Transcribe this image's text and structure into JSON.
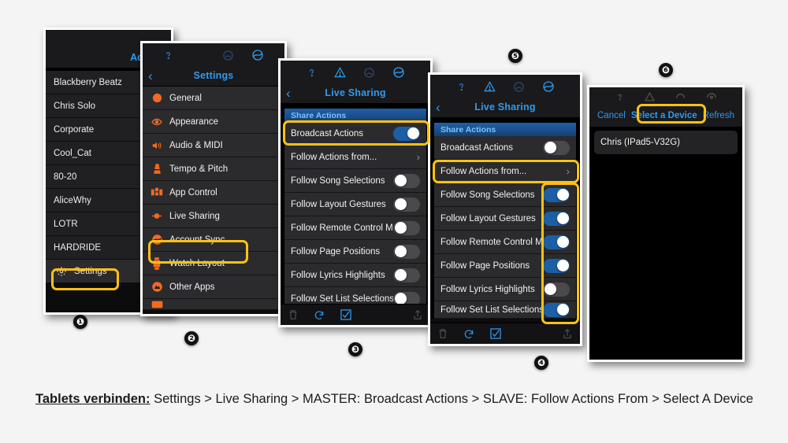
{
  "background_color": "#f4f4f4",
  "accent_highlight_color": "#fec212",
  "accent_blue": "#2f9aee",
  "toggle_on_color": "#1c5fa5",
  "toggle_off_color": "#4a4a4c",
  "panels": {
    "accounts": {
      "marker": "❶",
      "title": "Accoun",
      "items": [
        {
          "label": "Blackberry Beatz"
        },
        {
          "label": "Chris Solo"
        },
        {
          "label": "Corporate"
        },
        {
          "label": "Cool_Cat"
        },
        {
          "label": "80-20"
        },
        {
          "label": "AliceWhy"
        },
        {
          "label": "LOTR"
        },
        {
          "label": "HARDRIDE"
        }
      ],
      "settings_row": {
        "label": "Settings",
        "icon": "gear-icon",
        "highlighted": true
      }
    },
    "settings": {
      "marker": "❷",
      "title": "Settings",
      "back": "‹",
      "status_icons": [
        "help-icon",
        "metronome-icon",
        "sync-icon"
      ],
      "items": [
        {
          "label": "General",
          "icon": "gear-icon"
        },
        {
          "label": "Appearance",
          "icon": "eye-icon"
        },
        {
          "label": "Audio & MIDI",
          "icon": "speaker-icon"
        },
        {
          "label": "Tempo & Pitch",
          "icon": "metronome-icon"
        },
        {
          "label": "App Control",
          "icon": "app-control-icon"
        },
        {
          "label": "Live Sharing",
          "icon": "live-sharing-icon",
          "highlighted": true
        },
        {
          "label": "Account Sync",
          "icon": "sync-icon"
        },
        {
          "label": "Watch Layout",
          "icon": "watch-icon"
        },
        {
          "label": "Other Apps",
          "icon": "other-apps-icon"
        }
      ]
    },
    "live_sharing_master": {
      "marker": "❸",
      "title": "Live Sharing",
      "back": "‹",
      "status_icons": [
        "help-icon",
        "warning-icon",
        "metronome-icon",
        "live-sharing-icon"
      ],
      "section_header": "Share Actions",
      "rows": [
        {
          "label": "Broadcast Actions",
          "control": "toggle",
          "state": "on",
          "highlighted": true
        },
        {
          "label": "Follow Actions from...",
          "control": "chevron"
        },
        {
          "label": "Follow Song Selections",
          "control": "toggle",
          "state": "off"
        },
        {
          "label": "Follow Layout Gestures",
          "control": "toggle",
          "state": "off"
        },
        {
          "label": "Follow Remote Control Mes...",
          "control": "toggle",
          "state": "off"
        },
        {
          "label": "Follow Page Positions",
          "control": "toggle",
          "state": "off"
        },
        {
          "label": "Follow Lyrics Highlights",
          "control": "toggle",
          "state": "off"
        },
        {
          "label": "Follow Set List Selections",
          "control": "toggle",
          "state": "off"
        }
      ],
      "bottom_icons": [
        "trash-icon",
        "undo-icon",
        "checkbox-checked-icon",
        "share-icon"
      ]
    },
    "live_sharing_slave": {
      "marker": "❹",
      "header_marker": "❺",
      "title": "Live Sharing",
      "back": "‹",
      "status_icons": [
        "help-icon",
        "warning-icon",
        "metronome-icon",
        "live-sharing-icon"
      ],
      "section_header": "Share Actions",
      "rows": [
        {
          "label": "Broadcast Actions",
          "control": "toggle",
          "state": "off"
        },
        {
          "label": "Follow Actions from...",
          "control": "chevron",
          "highlighted": true
        },
        {
          "label": "Follow Song Selections",
          "control": "toggle",
          "state": "on"
        },
        {
          "label": "Follow Layout Gestures",
          "control": "toggle",
          "state": "on"
        },
        {
          "label": "Follow Remote Control Mes...",
          "control": "toggle",
          "state": "on"
        },
        {
          "label": "Follow Page Positions",
          "control": "toggle",
          "state": "on"
        },
        {
          "label": "Follow Lyrics Highlights",
          "control": "toggle",
          "state": "off"
        },
        {
          "label": "Follow Set List Selections",
          "control": "toggle",
          "state": "on"
        }
      ],
      "bottom_icons": [
        "trash-icon",
        "undo-icon",
        "checkbox-checked-icon",
        "share-icon"
      ]
    },
    "select_device": {
      "marker": "❻",
      "cancel_label": "Cancel",
      "title": "Select a Device",
      "refresh_label": "Refresh",
      "status_icons": [
        "help-icon",
        "warning-icon",
        "metronome-icon",
        "live-sharing-icon"
      ],
      "devices": [
        {
          "label": "Chris (IPad5-V32G)"
        }
      ]
    }
  },
  "caption": {
    "bold_prefix": "Tablets verbinden:",
    "rest": " Settings > Live Sharing > MASTER: Broadcast Actions > SLAVE: Follow Actions From > Select A Device"
  }
}
